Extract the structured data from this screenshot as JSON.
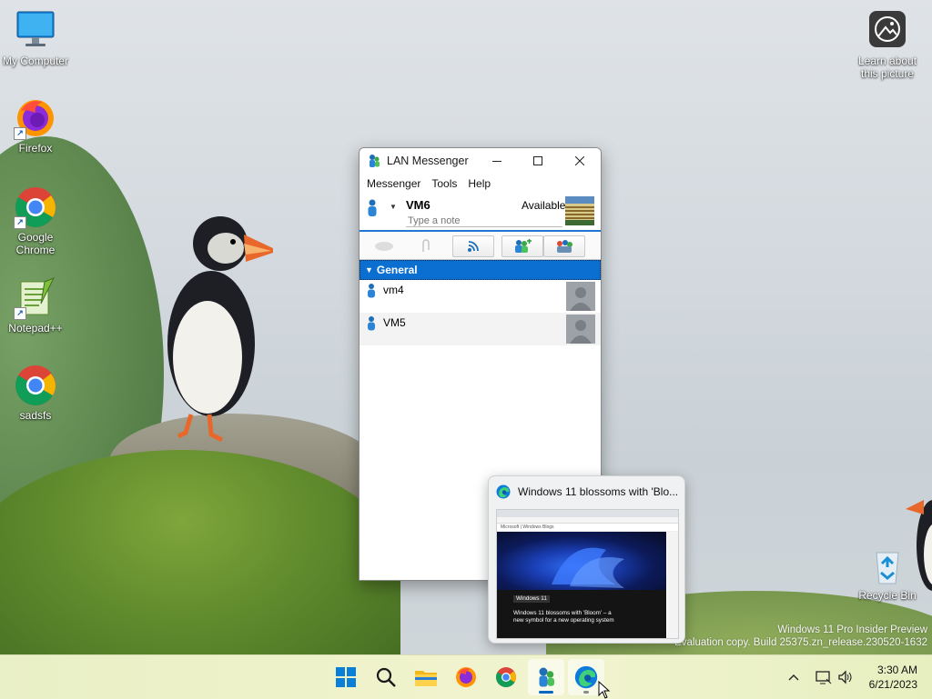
{
  "desktop": {
    "icons": [
      {
        "label": "My Computer"
      },
      {
        "label": "Firefox"
      },
      {
        "label": "Google Chrome"
      },
      {
        "label": "Notepad++"
      },
      {
        "label": "sadsfs"
      },
      {
        "label": "Learn about this picture"
      },
      {
        "label": "Recycle Bin"
      }
    ],
    "watermark": {
      "line1": "Windows 11 Pro Insider Preview",
      "line2": "Evaluation copy. Build 25375.zn_release.230520-1632"
    }
  },
  "messenger": {
    "title": "LAN Messenger",
    "menu": [
      "Messenger",
      "Tools",
      "Help"
    ],
    "user": {
      "name": "VM6",
      "status": "Available",
      "note_placeholder": "Type a note"
    },
    "group": {
      "name": "General"
    },
    "contacts": [
      {
        "name": "vm4"
      },
      {
        "name": "VM5"
      }
    ]
  },
  "preview": {
    "title": "Windows 11 blossoms with 'Blo...",
    "page_nav": "Microsoft | Windows Blogs",
    "page_tag": "Windows 11",
    "page_headline_1": "Windows 11 blossoms with 'Bloom' – a",
    "page_headline_2": "new symbol for a new operating system"
  },
  "taskbar": {
    "apps": [
      "Start",
      "Search",
      "File Explorer",
      "Firefox",
      "Google Chrome",
      "LAN Messenger",
      "Microsoft Edge"
    ],
    "clock": {
      "time": "3:30 AM",
      "date": "6/21/2023"
    }
  },
  "colors": {
    "accent": "#0067c0",
    "group_header": "#0a6fd1",
    "taskbar": "#eef2c9"
  }
}
